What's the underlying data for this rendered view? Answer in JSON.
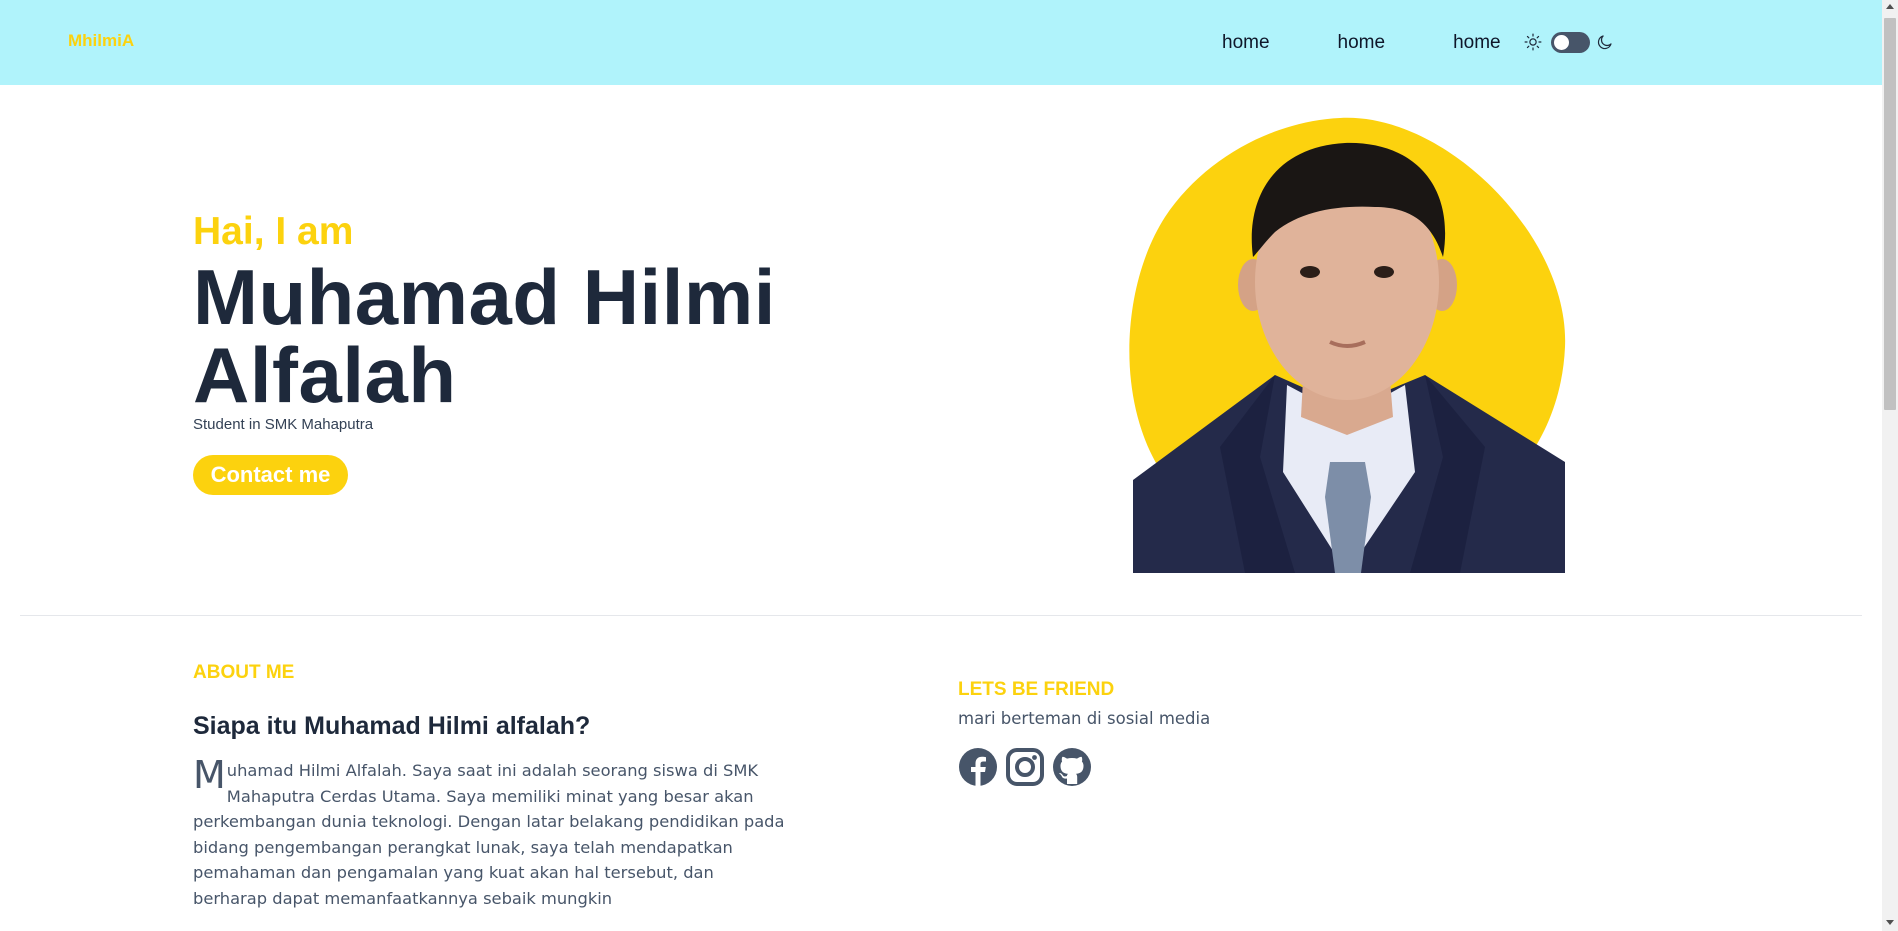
{
  "navbar": {
    "brand": "MhilmiA",
    "links": [
      "home",
      "home",
      "home"
    ],
    "sun_icon": "sun-icon",
    "moon_icon": "moon-icon",
    "theme_toggle": "dark-mode-toggle"
  },
  "hero": {
    "greeting": "Hai, I am",
    "name": "Muhamad Hilmi Alfalah",
    "role": "Student in SMK Mahaputra",
    "contact_label": "Contact me",
    "blob_color": "#fcd20e"
  },
  "about": {
    "label": "ABOUT ME",
    "title": "Siapa itu Muhamad Hilmi alfalah?",
    "dropcap": "M",
    "body": "uhamad Hilmi Alfalah. Saya saat ini adalah seorang siswa di SMK Mahaputra Cerdas Utama. Saya memiliki minat yang besar akan perkembangan dunia teknologi. Dengan latar belakang pendidikan pada bidang pengembangan perangkat lunak, saya telah mendapatkan pemahaman dan pengamalan yang kuat akan hal tersebut, dan berharap dapat memanfaatkannya sebaik mungkin"
  },
  "friends": {
    "label": "LETS BE FRIEND",
    "subtitle": "mari berteman di sosial media",
    "icons": [
      "facebook-icon",
      "instagram-icon",
      "github-icon"
    ]
  },
  "colors": {
    "navbar_bg": "#b0f3fb",
    "accent": "#fcd20e",
    "heading": "#1e293b",
    "body_text": "#475569"
  }
}
